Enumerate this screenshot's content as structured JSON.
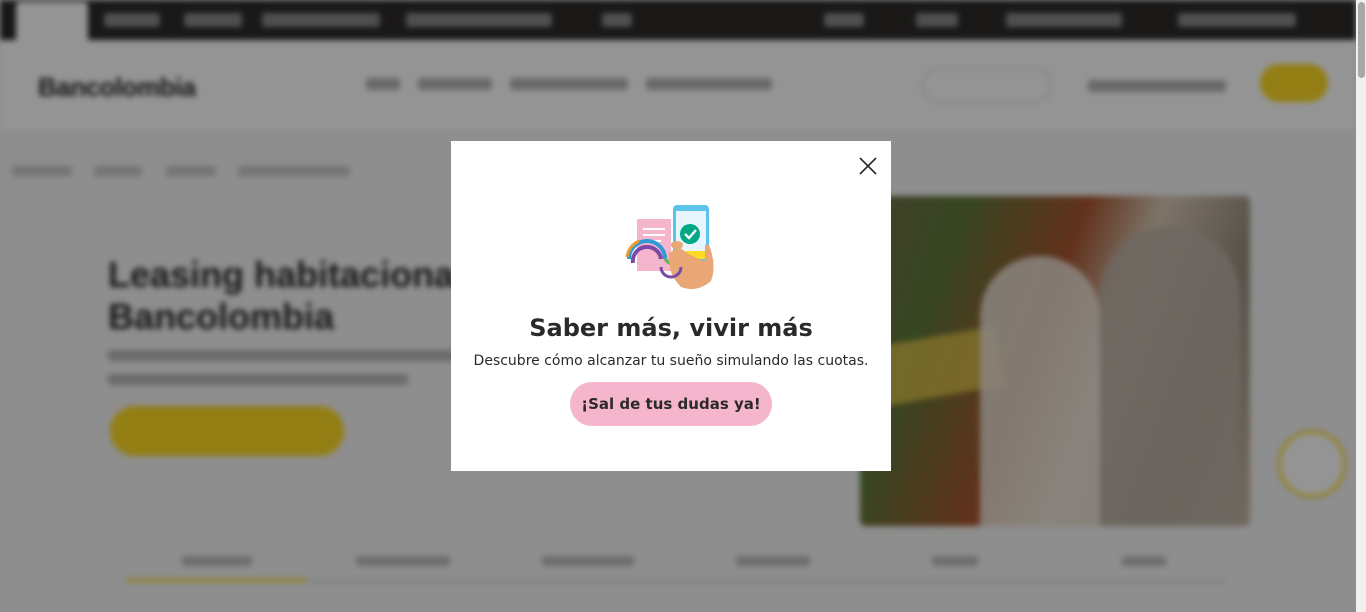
{
  "background_page": {
    "logo_text": "Bancolombia",
    "hero_title_line1": "Leasing habitacional",
    "hero_title_line2": "Bancolombia"
  },
  "modal": {
    "title": "Saber más, vivir más",
    "text": "Descubre cómo alcanzar tu sueño simulando las cuotas.",
    "cta_label": "¡Sal de tus dudas ya!",
    "close_icon": "close-icon",
    "illustration_icon": "phone-payment-icon"
  },
  "colors": {
    "brand_yellow": "#fdda24",
    "cta_pink": "#f5b5cc",
    "text_dark": "#2c2a29"
  }
}
